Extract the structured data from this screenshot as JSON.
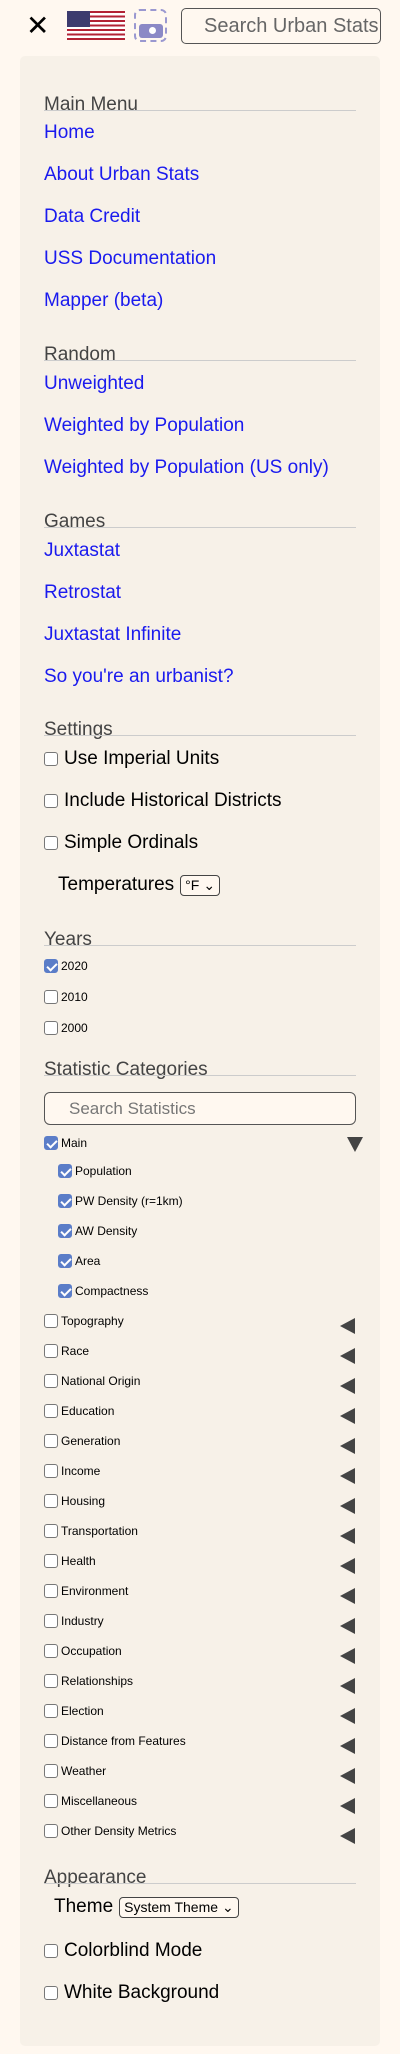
{
  "header": {
    "search_placeholder": "Search Urban Stats",
    "close_icon": "close-icon",
    "flag": "us-flag",
    "screenshot_icon": "camera-icon"
  },
  "main_menu": {
    "title": "Main Menu",
    "items": [
      "Home",
      "About Urban Stats",
      "Data Credit",
      "USS Documentation",
      "Mapper (beta)"
    ]
  },
  "random": {
    "title": "Random",
    "items": [
      "Unweighted",
      "Weighted by Population",
      "Weighted by Population (US only)"
    ]
  },
  "games": {
    "title": "Games",
    "items": [
      "Juxtastat",
      "Retrostat",
      "Juxtastat Infinite",
      "So you're an urbanist?"
    ]
  },
  "settings": {
    "title": "Settings",
    "checkboxes": [
      {
        "label": "Use Imperial Units",
        "checked": false
      },
      {
        "label": "Include Historical Districts",
        "checked": false
      },
      {
        "label": "Simple Ordinals",
        "checked": false
      }
    ],
    "temperatures_label": "Temperatures",
    "temperature_value": "°F"
  },
  "years": {
    "title": "Years",
    "items": [
      {
        "label": "2020",
        "checked": true
      },
      {
        "label": "2010",
        "checked": false
      },
      {
        "label": "2000",
        "checked": false
      }
    ]
  },
  "statistic_categories": {
    "title": "Statistic Categories",
    "search_placeholder": "Search Statistics",
    "main": {
      "label": "Main",
      "checked": true,
      "expanded": true,
      "children": [
        {
          "label": "Population",
          "checked": true
        },
        {
          "label": "PW Density (r=1km)",
          "checked": true
        },
        {
          "label": "AW Density",
          "checked": true
        },
        {
          "label": "Area",
          "checked": true
        },
        {
          "label": "Compactness",
          "checked": true
        }
      ]
    },
    "others": [
      "Topography",
      "Race",
      "National Origin",
      "Education",
      "Generation",
      "Income",
      "Housing",
      "Transportation",
      "Health",
      "Environment",
      "Industry",
      "Occupation",
      "Relationships",
      "Election",
      "Distance from Features",
      "Weather",
      "Miscellaneous",
      "Other Density Metrics"
    ]
  },
  "appearance": {
    "title": "Appearance",
    "theme_label": "Theme",
    "theme_value": "System Theme",
    "checkboxes": [
      {
        "label": "Colorblind Mode",
        "checked": false
      },
      {
        "label": "White Background",
        "checked": false
      }
    ]
  }
}
